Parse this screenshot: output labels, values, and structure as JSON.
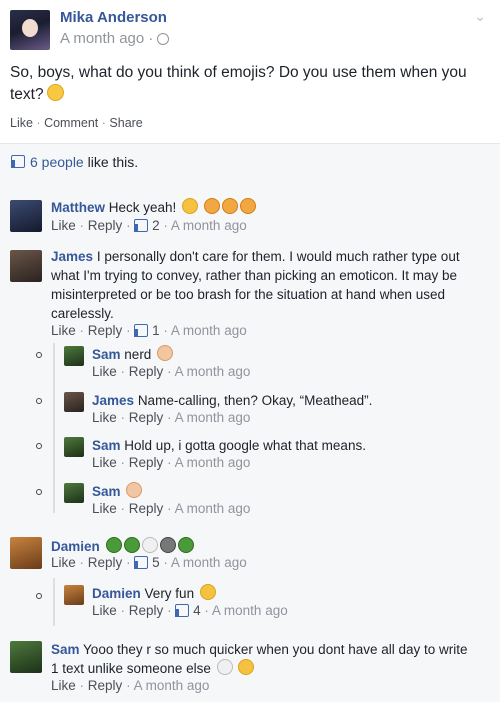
{
  "post": {
    "author": "Mika Anderson",
    "time": "A month ago ·",
    "text": "So, boys, what do you think of emojis? Do you use them when you text?",
    "actions": {
      "like": "Like",
      "comment": "Comment",
      "share": "Share"
    },
    "likes_count": "6 people",
    "likes_suffix": "like this."
  },
  "actions": {
    "like": "Like",
    "reply": "Reply"
  },
  "comments": [
    {
      "author": "Matthew",
      "text": "Heck yeah!",
      "likes": "2",
      "time": "A month ago"
    },
    {
      "author": "James",
      "text": "I personally don't care for them. I would much rather type out what I'm trying to convey, rather than picking an emoticon. It may be misinterpreted or be too brash for the situation at hand when used carelessly.",
      "likes": "1",
      "time": "A month ago",
      "replies": [
        {
          "author": "Sam",
          "text": "nerd",
          "time": "A month ago"
        },
        {
          "author": "James",
          "text": "Name-calling, then? Okay, “Meathead”.",
          "time": "A month ago"
        },
        {
          "author": "Sam",
          "text": "Hold up, i gotta google what that means.",
          "time": "A month ago"
        },
        {
          "author": "Sam",
          "text": "",
          "time": "A month ago"
        }
      ]
    },
    {
      "author": "Damien",
      "text": "",
      "likes": "5",
      "time": "A month ago",
      "replies": [
        {
          "author": "Damien",
          "text": "Very fun",
          "likes": "4",
          "time": "A month ago"
        }
      ]
    },
    {
      "author": "Sam",
      "text": "Yooo they r so much quicker when you dont have all day to write 1 text unlike someone else",
      "time": "A month ago"
    }
  ],
  "sep": "·"
}
